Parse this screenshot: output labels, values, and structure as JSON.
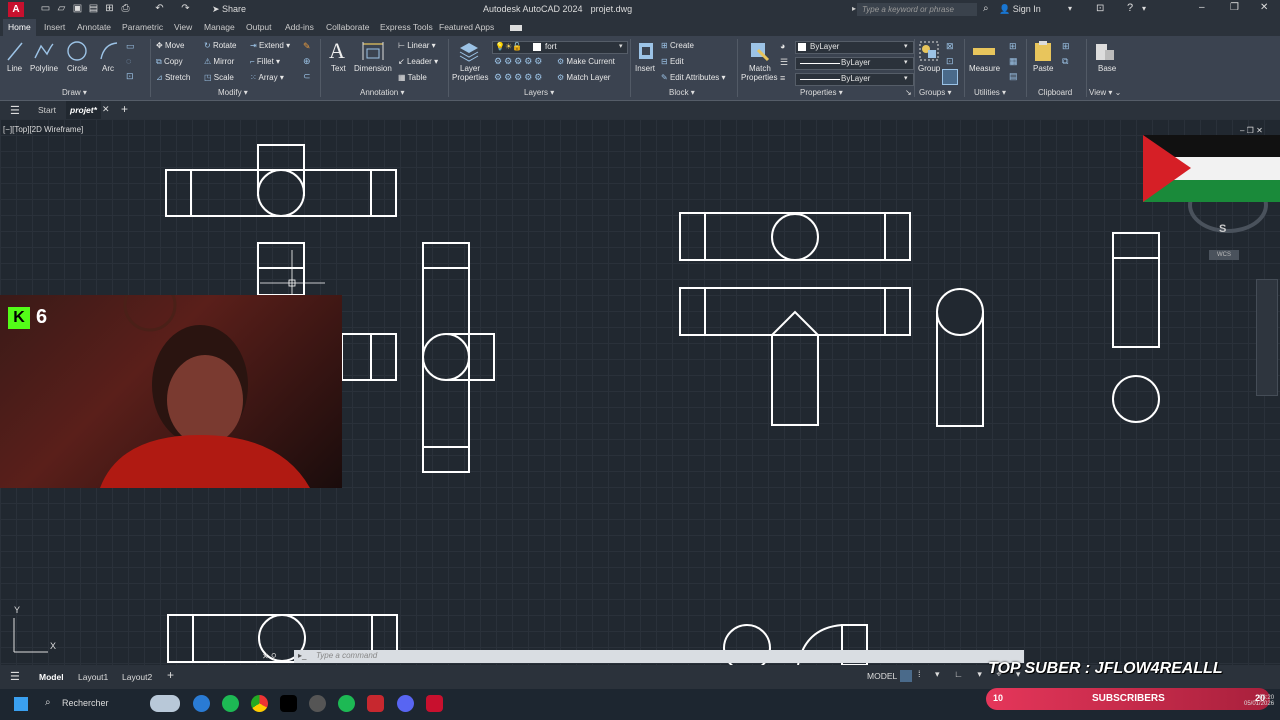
{
  "window": {
    "app_title": "Autodesk AutoCAD 2024",
    "file_name": "projet.dwg",
    "search_placeholder": "Type a keyword or phrase",
    "sign_in": "Sign In",
    "share": "Share",
    "app_logo": "A"
  },
  "ribbon_tabs": [
    "Home",
    "Insert",
    "Annotate",
    "Parametric",
    "View",
    "Manage",
    "Output",
    "Add-ins",
    "Collaborate",
    "Express Tools",
    "Featured Apps"
  ],
  "draw_panel": {
    "line": "Line",
    "polyline": "Polyline",
    "circle": "Circle",
    "arc": "Arc",
    "title": "Draw"
  },
  "modify_panel": {
    "move": "Move",
    "rotate": "Rotate",
    "extend": "Extend",
    "copy": "Copy",
    "mirror": "Mirror",
    "fillet": "Fillet",
    "stretch": "Stretch",
    "scale": "Scale",
    "array": "Array",
    "title": "Modify"
  },
  "annotation_panel": {
    "text": "Text",
    "dimension": "Dimension",
    "linear": "Linear",
    "leader": "Leader",
    "table": "Table",
    "title": "Annotation"
  },
  "layers_panel": {
    "layer_properties_1": "Layer",
    "layer_properties_2": "Properties",
    "current_layer": "fort",
    "make_current": "Make Current",
    "match_layer": "Match Layer",
    "title": "Layers"
  },
  "block_panel": {
    "insert": "Insert",
    "create": "Create",
    "edit": "Edit",
    "edit_attributes": "Edit Attributes",
    "title": "Block"
  },
  "properties_panel": {
    "match_1": "Match",
    "match_2": "Properties",
    "color": "ByLayer",
    "linetype": "ByLayer",
    "lineweight": "ByLayer",
    "title": "Properties"
  },
  "groups_panel": {
    "group": "Group",
    "title": "Groups"
  },
  "utilities_panel": {
    "measure": "Measure",
    "title": "Utilities"
  },
  "clipboard_panel": {
    "paste": "Paste",
    "title": "Clipboard"
  },
  "view_panel": {
    "base": "Base",
    "title": "View"
  },
  "file_tabs": {
    "start": "Start",
    "active": "projet*"
  },
  "viewport_label": "[−][Top][2D Wireframe]",
  "viewcube": {
    "south": "S",
    "wcs": "WCS"
  },
  "ucs": {
    "x": "X",
    "y": "Y"
  },
  "command_placeholder": "Type a command",
  "layout_tabs": [
    "Model",
    "Layout1",
    "Layout2"
  ],
  "status": {
    "model": "MODEL"
  },
  "taskbar": {
    "search": "Rechercher",
    "time": "03:20",
    "date": "05/01/2026"
  },
  "overlay": {
    "top_suber": "TOP SUBER : JFLOW4REALLL",
    "subscribers_count": "10",
    "subscribers_label": "SUBSCRIBERS",
    "subscribers_goal": "20",
    "kick_count": "6"
  },
  "colors": {
    "ribbon": "#3b4350",
    "canvas": "#212830",
    "accent_red": "#c8102e",
    "overlay_pink": "#e5365a"
  }
}
